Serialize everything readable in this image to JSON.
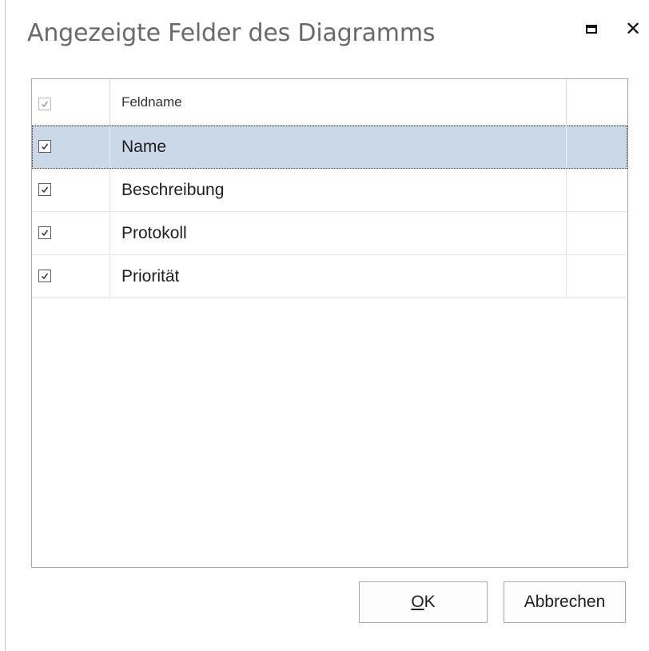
{
  "dialog": {
    "title": "Angezeigte Felder des Diagramms",
    "maximize_icon": "maximize-icon",
    "close_icon": "close-icon",
    "close_glyph": "✕"
  },
  "grid": {
    "columns": [
      "",
      "Feldname",
      ""
    ],
    "header_checked": true,
    "rows": [
      {
        "checked": true,
        "name": "Name",
        "selected": true
      },
      {
        "checked": true,
        "name": "Beschreibung",
        "selected": false
      },
      {
        "checked": true,
        "name": "Protokoll",
        "selected": false
      },
      {
        "checked": true,
        "name": "Priorität",
        "selected": false
      }
    ]
  },
  "buttons": {
    "ok_mnemonic": "O",
    "ok_rest": "K",
    "cancel_label": "Abbrechen"
  },
  "colors": {
    "selection": "#cbd8e8",
    "title_text": "#6a6a6a"
  }
}
